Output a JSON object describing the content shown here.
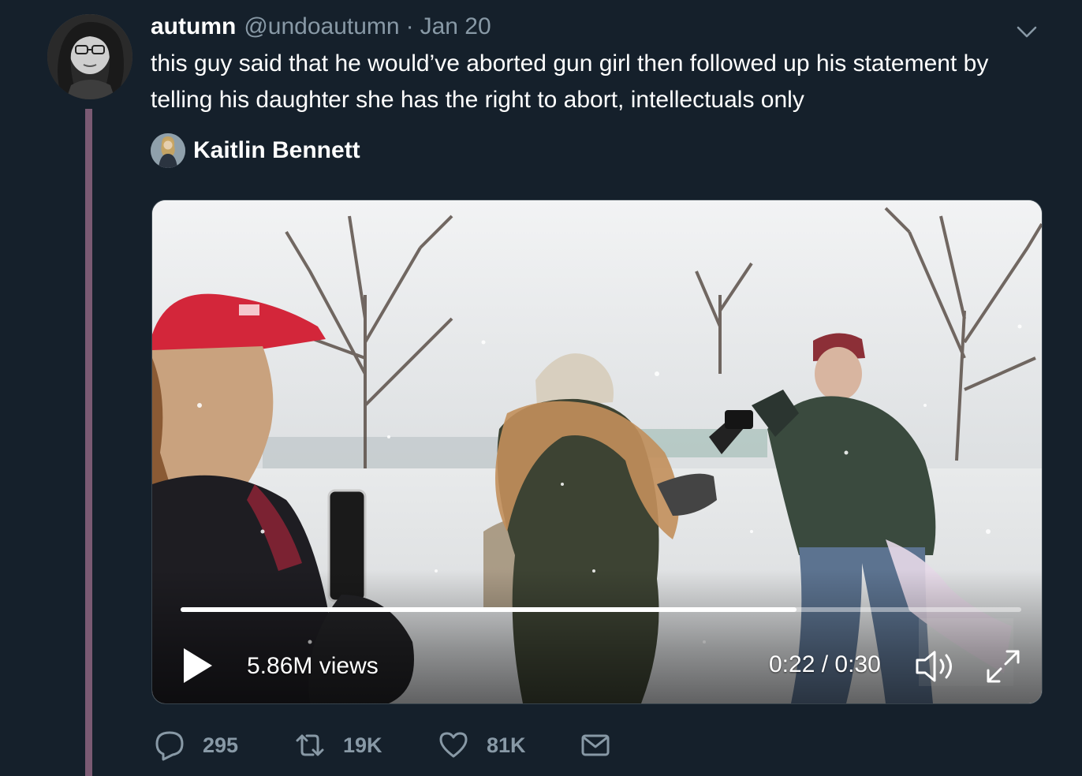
{
  "tweet": {
    "display_name": "autumn",
    "handle": "@undoautumn",
    "separator": "·",
    "date": "Jan 20",
    "text": "this guy said that he would’ve aborted gun girl then followed up his statement by telling his daughter she has the right to abort, intellectuals only"
  },
  "quoted": {
    "author_name": "Kaitlin Bennett"
  },
  "video": {
    "views": "5.86M views",
    "timecode": "0:22 / 0:30",
    "progress": 0.733
  },
  "actions": {
    "replies": "295",
    "retweets": "19K",
    "likes": "81K"
  },
  "colors": {
    "background": "#15202b",
    "secondary_text": "#8899a6",
    "thread_line": "#7a5a73"
  }
}
